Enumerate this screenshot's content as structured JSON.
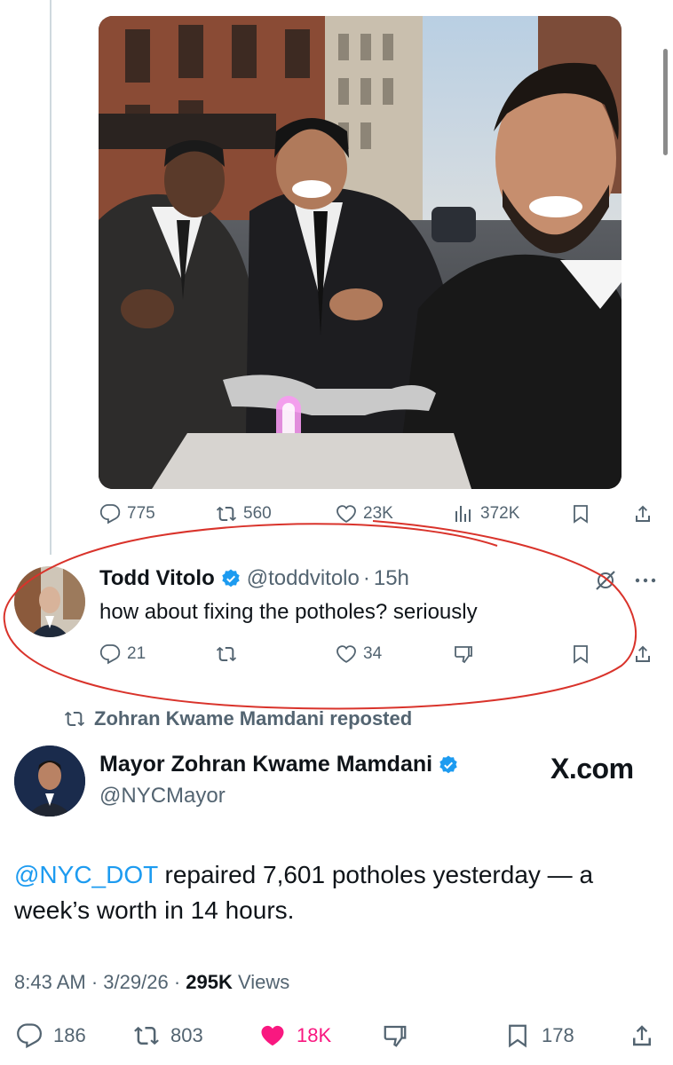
{
  "previous_tweet": {
    "metrics": {
      "replies": "775",
      "reposts": "560",
      "likes": "23K",
      "views": "372K"
    }
  },
  "reply": {
    "author_name": "Todd Vitolo",
    "handle": "@toddvitolo",
    "separator": "·",
    "time": "15h",
    "text": "how about fixing the potholes? seriously",
    "metrics": {
      "replies": "21",
      "likes": "34"
    }
  },
  "repost_banner": "Zohran Kwame Mamdani reposted",
  "main_tweet": {
    "author_name": "Mayor Zohran Kwame Mamdani",
    "handle": "@NYCMayor",
    "mention": "@NYC_DOT",
    "text": " repaired 7,601 potholes yesterday — a week’s worth in 14 hours.",
    "time": "8:43 AM",
    "date": "3/29/26",
    "views_count": "295K",
    "views_label": "Views",
    "dot": "·",
    "metrics": {
      "replies": "186",
      "reposts": "803",
      "likes": "18K",
      "bookmarks": "178"
    }
  },
  "watermark": "X.com",
  "colors": {
    "accent_blue": "#1d9bf0",
    "like_pink": "#f91880",
    "annotation_red": "#d9332b",
    "muted_text": "#536471"
  },
  "icons": [
    "reply-icon",
    "repost-icon",
    "like-icon",
    "views-icon",
    "bookmark-icon",
    "share-icon",
    "dislike-icon",
    "verified-badge-icon",
    "more-icon",
    "grok-icon"
  ]
}
